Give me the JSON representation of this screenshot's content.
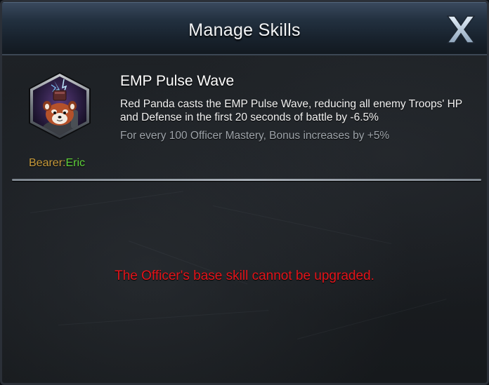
{
  "window": {
    "title": "Manage Skills",
    "close_icon": "close-x-icon"
  },
  "skill": {
    "icon": "red-panda-officer-icon",
    "name": "EMP Pulse Wave",
    "description": "Red Panda casts the EMP Pulse Wave, reducing all enemy Troops' HP and Defense in the first 20 seconds of battle by -6.5%",
    "bonus": "For every 100 Officer Mastery, Bonus increases by +5%",
    "bearer_label": "Bearer:",
    "bearer_name": "Eric"
  },
  "notice": "The Officer's base skill cannot be upgraded.",
  "colors": {
    "bearer_label": "#c79a3b",
    "bearer_name": "#5fd13a",
    "notice": "#e3141a",
    "bonus": "#9ea4aa"
  }
}
